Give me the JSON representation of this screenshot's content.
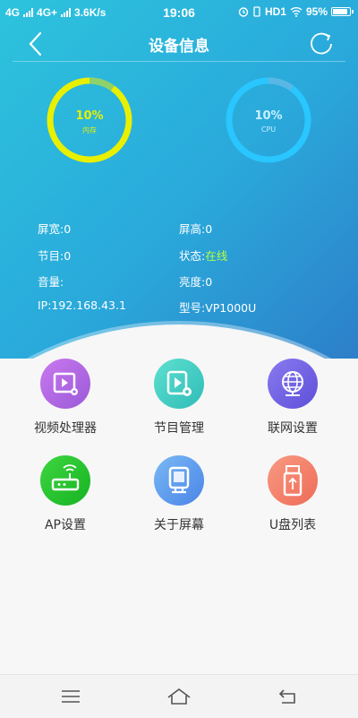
{
  "status_bar": {
    "network1": "4G",
    "network2": "4G+",
    "speed": "3.6K/s",
    "time": "19:06",
    "hd": "HD1",
    "battery": "95%"
  },
  "header": {
    "title": "设备信息"
  },
  "gauges": {
    "memory": {
      "percent_text": "10%",
      "label": "内存",
      "value": 0.1,
      "color": "#e8f000"
    },
    "cpu": {
      "percent_text": "10%",
      "label": "CPU",
      "value": 0.1,
      "color": "#29c6ff"
    }
  },
  "info": {
    "screen_width": "屏宽:0",
    "screen_height": "屏高:0",
    "program": "节目:0",
    "status_label": "状态:",
    "status_value": "在线",
    "volume": "音量:",
    "brightness": "亮度:0",
    "ip": "IP:192.168.43.1",
    "model": "型号:VP1000U"
  },
  "menu": [
    {
      "label": "视频处理器",
      "icon": "video-processor-icon",
      "color": "#b46be6"
    },
    {
      "label": "节目管理",
      "icon": "program-icon",
      "color": "#43d2c6"
    },
    {
      "label": "联网设置",
      "icon": "globe-icon",
      "color": "#7a67e8"
    },
    {
      "label": "AP设置",
      "icon": "router-icon",
      "color": "#22c42f"
    },
    {
      "label": "关于屏幕",
      "icon": "screen-icon",
      "color": "#5c9bf0"
    },
    {
      "label": "U盘列表",
      "icon": "usb-icon",
      "color": "#f4806a"
    }
  ]
}
